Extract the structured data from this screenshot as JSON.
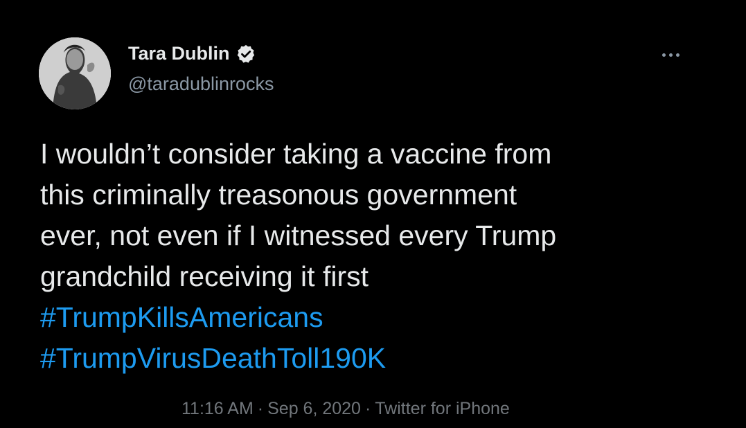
{
  "tweet": {
    "author": {
      "display_name": "Tara Dublin",
      "handle": "@taradublinrocks",
      "verified": true
    },
    "more_icon": "more-horizontal-icon",
    "text_lines": [
      "I wouldn’t consider taking a vaccine from",
      "this criminally treasonous government",
      "ever, not even if I witnessed every Trump",
      "grandchild receiving it first"
    ],
    "hashtags": [
      "#TrumpKillsAmericans",
      "#TrumpVirusDeathToll190K"
    ],
    "time": "11:16 AM",
    "date": "Sep 6, 2020",
    "source": "Twitter for iPhone",
    "separator": "·"
  },
  "colors": {
    "background": "#000000",
    "text_primary": "#e7e9ea",
    "text_secondary": "#8b98a5",
    "meta_text": "#71767b",
    "link": "#1d9bf0"
  }
}
